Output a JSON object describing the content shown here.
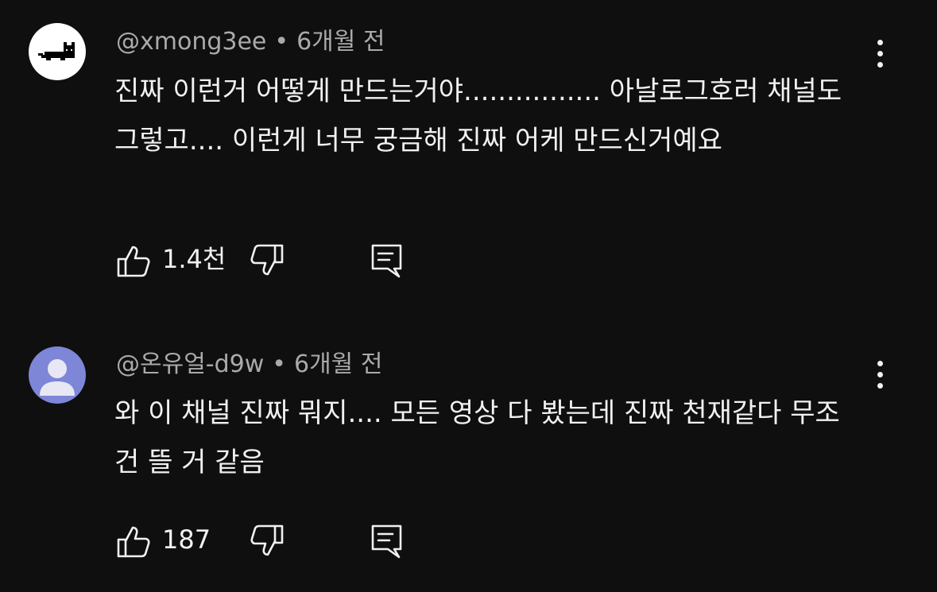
{
  "comments": [
    {
      "username": "@xmong3ee",
      "separator": "•",
      "time": "6개월 전",
      "text": "진짜 이런거 어떻게 만드는거야................ 아날로그호러 채널도 그렇고.... 이런게 너무 궁금해 진짜 어케 만드신거예요",
      "likes": "1.4천",
      "avatar": "black-cat-avatar"
    },
    {
      "username": "@온유얼-d9w",
      "separator": "•",
      "time": "6개월 전",
      "text": "와 이 채널 진짜 뭐지.... 모든 영상 다 봤는데 진짜 천재같다 무조건 뜰 거 같음",
      "likes": "187",
      "avatar": "default-person-avatar"
    }
  ],
  "icons": {
    "like": "thumbs-up-icon",
    "dislike": "thumbs-down-icon",
    "reply": "reply-comment-icon",
    "more": "more-vertical-icon"
  },
  "colors": {
    "background": "#0f0f0f",
    "text": "#f1f1f1",
    "meta": "#aaaaaa",
    "avatar_purple": "#7e86d8"
  }
}
